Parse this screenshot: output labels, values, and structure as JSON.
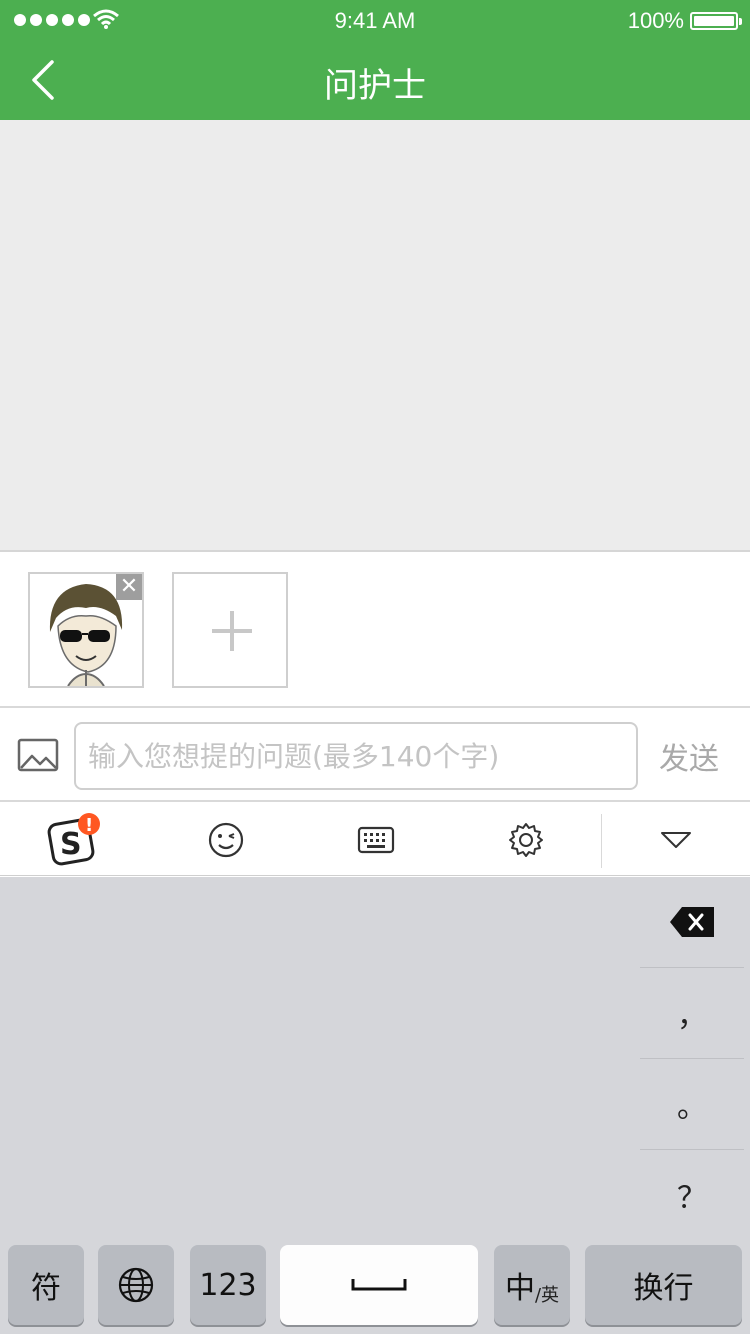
{
  "status_bar": {
    "time": "9:41 AM",
    "battery": "100%"
  },
  "nav": {
    "title": "问护士",
    "back_icon": "chevron-left-icon"
  },
  "attachments": {
    "remove_label": "✕",
    "add_icon": "plus-icon"
  },
  "composer": {
    "placeholder": "输入您想提的问题(最多140个字)",
    "value": "",
    "send_label": "发送",
    "image_icon": "image-icon"
  },
  "ime_toolbar": {
    "items": [
      {
        "icon": "sogou-logo-icon",
        "badge": "!"
      },
      {
        "icon": "emoji-wink-icon"
      },
      {
        "icon": "keyboard-icon"
      },
      {
        "icon": "gear-icon"
      },
      {
        "icon": "triangle-down-icon"
      }
    ]
  },
  "keyboard": {
    "side_keys": {
      "comma": "，",
      "period": "。",
      "question": "？"
    },
    "bottom_row": {
      "symbols": "符",
      "numbers": "123",
      "zh_main": "中",
      "zh_sub": "/英",
      "enter": "换行"
    }
  },
  "colors": {
    "brand_green": "#4caf50",
    "chat_bg": "#ececec",
    "keyboard_bg": "#d5d6da",
    "badge_orange": "#ff5722"
  }
}
